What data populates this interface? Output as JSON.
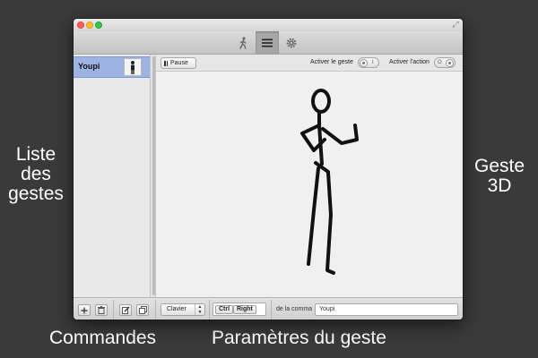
{
  "callouts": {
    "gesture_list": "Liste des gestes",
    "gesture_3d": "Geste 3D",
    "commands": "Commandes",
    "gesture_params": "Paramètres du geste"
  },
  "toolbar": {
    "buttons": [
      {
        "icon": "walking-person-icon",
        "selected": false
      },
      {
        "icon": "list-icon",
        "selected": true
      },
      {
        "icon": "gear-icon",
        "selected": false
      }
    ]
  },
  "sidebar": {
    "items": [
      {
        "label": "Youpi",
        "selected": true,
        "icon": "person-thumbnail-icon"
      }
    ]
  },
  "main": {
    "pause_label": "Pause",
    "activate_gesture_label": "Activer le geste",
    "activate_action_label": "Activer l'action",
    "activate_gesture_mark": "I",
    "activate_action_mark": "O"
  },
  "bottom": {
    "input_type": "Clavier",
    "keys": [
      "Ctrl",
      "Right"
    ],
    "command_label": "de la comma",
    "command_value": "Youpi"
  },
  "colors": {
    "background": "#3a3a3a",
    "selection": "#9cb3e3",
    "figure": "#111111"
  }
}
